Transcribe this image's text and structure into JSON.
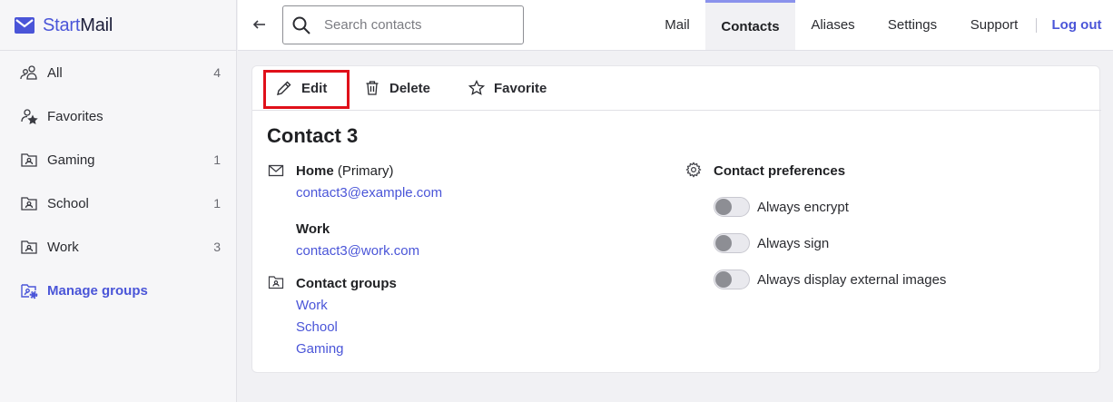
{
  "app": {
    "brand_start": "Start",
    "brand_mail": "Mail",
    "accent_color": "#4a55d8",
    "highlight_color": "#e0101a"
  },
  "sidebar": {
    "items": [
      {
        "label": "All",
        "count": "4",
        "icon": "contacts-all-icon"
      },
      {
        "label": "Favorites",
        "count": "",
        "icon": "favorites-person-star-icon"
      },
      {
        "label": "Gaming",
        "count": "1",
        "icon": "group-folder-icon"
      },
      {
        "label": "School",
        "count": "1",
        "icon": "group-folder-icon"
      },
      {
        "label": "Work",
        "count": "3",
        "icon": "group-folder-icon"
      }
    ],
    "manage_label": "Manage groups"
  },
  "topbar": {
    "search_placeholder": "Search contacts",
    "tabs": [
      {
        "label": "Mail",
        "active": false
      },
      {
        "label": "Contacts",
        "active": true
      },
      {
        "label": "Aliases",
        "active": false
      },
      {
        "label": "Settings",
        "active": false
      },
      {
        "label": "Support",
        "active": false
      }
    ],
    "logout_label": "Log out"
  },
  "toolbar": {
    "edit_label": "Edit",
    "delete_label": "Delete",
    "favorite_label": "Favorite"
  },
  "contact": {
    "name": "Contact 3",
    "emails": [
      {
        "type": "Home",
        "note": "(Primary)",
        "address": "contact3@example.com"
      },
      {
        "type": "Work",
        "note": "",
        "address": "contact3@work.com"
      }
    ],
    "groups_title": "Contact groups",
    "groups": [
      "Work",
      "School",
      "Gaming"
    ],
    "preferences_title": "Contact preferences",
    "preferences": [
      {
        "label": "Always encrypt",
        "enabled": false
      },
      {
        "label": "Always sign",
        "enabled": false
      },
      {
        "label": "Always display external images",
        "enabled": false
      }
    ]
  }
}
